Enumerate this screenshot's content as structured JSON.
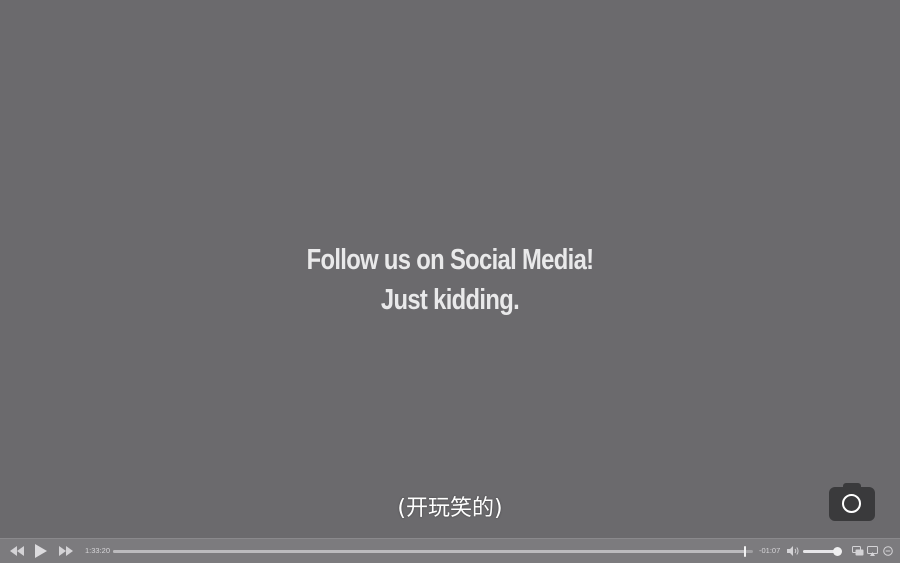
{
  "player": {
    "title_card": {
      "line1": "Follow us on Social Media!",
      "line2": "Just kidding."
    },
    "subtitle": "(开玩笑的)",
    "controls": {
      "rewind_icon": "rewind-icon",
      "play_icon": "play-icon",
      "fast_forward_icon": "fast-forward-icon",
      "elapsed_time": "1:33:20",
      "remaining_time": "-01:07",
      "progress_fraction": 0.988,
      "volume_icon": "speaker-icon",
      "volume_fraction": 0.95,
      "subtitles_icon": "subtitles-icon",
      "airplay_icon": "airplay-icon",
      "more_icon": "more-icon"
    },
    "camera_icon": "camera-icon",
    "colors": {
      "background": "#6b6a6d",
      "control_bar": "#7c7b7e",
      "title_text": "#e9e9ea",
      "subtitle_text": "#ffffff"
    }
  }
}
